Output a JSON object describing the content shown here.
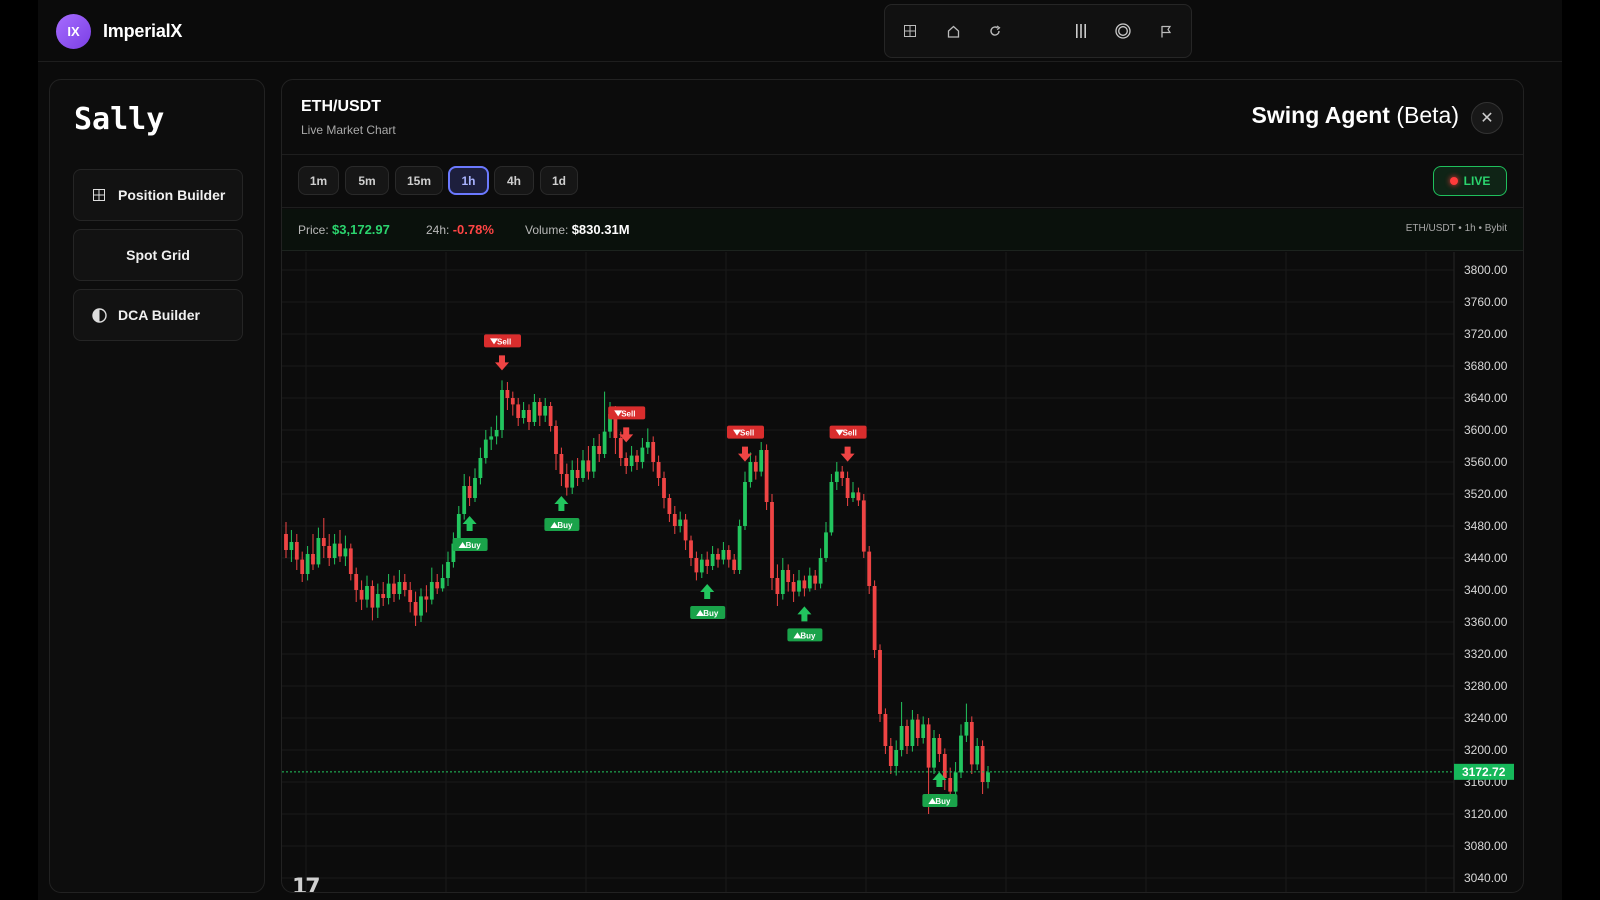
{
  "brand": {
    "logo_text": "IX",
    "name": "ImperialX"
  },
  "toolbar": {
    "icons": [
      "grid-icon",
      "home-icon",
      "refresh-icon",
      "bars-icon",
      "target-icon",
      "flag-icon"
    ]
  },
  "left_panel": {
    "title": "Sally",
    "items": [
      {
        "label": "Position Builder",
        "icon": "grid-icon"
      },
      {
        "label": "Spot Grid"
      },
      {
        "label": "DCA Builder",
        "icon": "half-circle-icon"
      }
    ]
  },
  "chart_panel": {
    "pair": "ETH/USDT",
    "subtitle": "Live Market Chart",
    "agent_name": "Swing Agent",
    "agent_tag": "(Beta)",
    "close_label": "✕",
    "timeframes": [
      "1m",
      "5m",
      "15m",
      "1h",
      "4h",
      "1d"
    ],
    "active_timeframe": "1h",
    "live_label": "LIVE",
    "stats": {
      "price_label": "Price:",
      "price_value": "$3,172.97",
      "change_label": "24h:",
      "change_value": "-0.78%",
      "volume_label": "Volume:",
      "volume_value": "$830.31M",
      "meta": "ETH/USDT • 1h • Bybit"
    },
    "tv_logo": "17",
    "colors": {
      "up": "#22c55e",
      "down": "#ef4444",
      "accent": "#6b79ff",
      "live": "#2bd46e"
    }
  },
  "chart_data": {
    "type": "candlestick",
    "y_ticks": [
      3800,
      3760,
      3720,
      3680,
      3640,
      3600,
      3560,
      3520,
      3480,
      3440,
      3400,
      3360,
      3320,
      3280,
      3240,
      3200,
      3160,
      3120,
      3080,
      3040
    ],
    "ylim": [
      3030,
      3810
    ],
    "current_price": "3172.72",
    "current_value": 3172.72,
    "grid": true,
    "candles": [
      [
        3470,
        3450,
        3485,
        3440
      ],
      [
        3450,
        3460,
        3475,
        3435
      ],
      [
        3460,
        3438,
        3470,
        3425
      ],
      [
        3438,
        3420,
        3448,
        3410
      ],
      [
        3420,
        3445,
        3455,
        3412
      ],
      [
        3445,
        3432,
        3470,
        3425
      ],
      [
        3432,
        3465,
        3478,
        3428
      ],
      [
        3465,
        3455,
        3490,
        3440
      ],
      [
        3455,
        3440,
        3470,
        3430
      ],
      [
        3440,
        3458,
        3470,
        3432
      ],
      [
        3458,
        3442,
        3475,
        3435
      ],
      [
        3442,
        3452,
        3468,
        3430
      ],
      [
        3452,
        3420,
        3458,
        3412
      ],
      [
        3420,
        3400,
        3428,
        3385
      ],
      [
        3400,
        3388,
        3412,
        3375
      ],
      [
        3388,
        3405,
        3418,
        3378
      ],
      [
        3405,
        3378,
        3412,
        3362
      ],
      [
        3378,
        3395,
        3408,
        3365
      ],
      [
        3395,
        3390,
        3410,
        3380
      ],
      [
        3390,
        3408,
        3420,
        3382
      ],
      [
        3408,
        3395,
        3418,
        3385
      ],
      [
        3395,
        3410,
        3425,
        3388
      ],
      [
        3410,
        3400,
        3420,
        3392
      ],
      [
        3400,
        3385,
        3410,
        3372
      ],
      [
        3385,
        3368,
        3398,
        3355
      ],
      [
        3368,
        3392,
        3402,
        3360
      ],
      [
        3392,
        3388,
        3406,
        3372
      ],
      [
        3388,
        3410,
        3428,
        3382
      ],
      [
        3410,
        3402,
        3420,
        3395
      ],
      [
        3402,
        3415,
        3432,
        3398
      ],
      [
        3415,
        3435,
        3448,
        3405
      ],
      [
        3435,
        3458,
        3472,
        3428
      ],
      [
        3458,
        3495,
        3505,
        3450
      ],
      [
        3495,
        3530,
        3545,
        3488
      ],
      [
        3530,
        3515,
        3542,
        3505
      ],
      [
        3515,
        3540,
        3552,
        3510
      ],
      [
        3540,
        3565,
        3578,
        3532
      ],
      [
        3565,
        3588,
        3600,
        3558
      ],
      [
        3588,
        3592,
        3604,
        3575
      ],
      [
        3592,
        3600,
        3618,
        3582
      ],
      [
        3600,
        3650,
        3662,
        3590
      ],
      [
        3650,
        3640,
        3660,
        3625
      ],
      [
        3640,
        3632,
        3648,
        3618
      ],
      [
        3632,
        3615,
        3640,
        3605
      ],
      [
        3615,
        3625,
        3635,
        3608
      ],
      [
        3625,
        3610,
        3632,
        3600
      ],
      [
        3610,
        3635,
        3645,
        3605
      ],
      [
        3635,
        3618,
        3640,
        3605
      ],
      [
        3618,
        3630,
        3640,
        3610
      ],
      [
        3630,
        3605,
        3635,
        3598
      ],
      [
        3605,
        3570,
        3612,
        3550
      ],
      [
        3570,
        3545,
        3578,
        3530
      ],
      [
        3545,
        3528,
        3558,
        3518
      ],
      [
        3528,
        3550,
        3562,
        3520
      ],
      [
        3550,
        3540,
        3565,
        3530
      ],
      [
        3540,
        3562,
        3575,
        3535
      ],
      [
        3562,
        3548,
        3580,
        3538
      ],
      [
        3548,
        3580,
        3590,
        3540
      ],
      [
        3580,
        3570,
        3595,
        3560
      ],
      [
        3570,
        3598,
        3648,
        3565
      ],
      [
        3598,
        3620,
        3635,
        3590
      ],
      [
        3620,
        3590,
        3630,
        3570
      ],
      [
        3590,
        3565,
        3598,
        3555
      ],
      [
        3565,
        3555,
        3572,
        3545
      ],
      [
        3555,
        3568,
        3580,
        3548
      ],
      [
        3568,
        3560,
        3575,
        3550
      ],
      [
        3560,
        3578,
        3590,
        3552
      ],
      [
        3578,
        3585,
        3602,
        3570
      ],
      [
        3585,
        3560,
        3592,
        3548
      ],
      [
        3560,
        3540,
        3568,
        3530
      ],
      [
        3540,
        3515,
        3548,
        3502
      ],
      [
        3515,
        3495,
        3520,
        3485
      ],
      [
        3495,
        3480,
        3505,
        3470
      ],
      [
        3480,
        3488,
        3498,
        3472
      ],
      [
        3488,
        3462,
        3495,
        3450
      ],
      [
        3462,
        3440,
        3468,
        3430
      ],
      [
        3440,
        3422,
        3448,
        3412
      ],
      [
        3422,
        3438,
        3445,
        3415
      ],
      [
        3438,
        3430,
        3448,
        3420
      ],
      [
        3430,
        3445,
        3455,
        3425
      ],
      [
        3445,
        3438,
        3452,
        3428
      ],
      [
        3438,
        3450,
        3460,
        3432
      ],
      [
        3450,
        3438,
        3456,
        3428
      ],
      [
        3438,
        3425,
        3445,
        3420
      ],
      [
        3425,
        3480,
        3488,
        3420
      ],
      [
        3480,
        3535,
        3548,
        3475
      ],
      [
        3535,
        3560,
        3572,
        3528
      ],
      [
        3560,
        3548,
        3568,
        3538
      ],
      [
        3548,
        3575,
        3585,
        3542
      ],
      [
        3575,
        3510,
        3582,
        3500
      ],
      [
        3510,
        3415,
        3520,
        3400
      ],
      [
        3415,
        3395,
        3432,
        3380
      ],
      [
        3395,
        3425,
        3440,
        3388
      ],
      [
        3425,
        3410,
        3432,
        3398
      ],
      [
        3410,
        3398,
        3420,
        3385
      ],
      [
        3398,
        3412,
        3425,
        3392
      ],
      [
        3412,
        3402,
        3418,
        3392
      ],
      [
        3402,
        3418,
        3428,
        3398
      ],
      [
        3418,
        3408,
        3425,
        3400
      ],
      [
        3408,
        3440,
        3452,
        3402
      ],
      [
        3440,
        3472,
        3485,
        3435
      ],
      [
        3472,
        3535,
        3545,
        3468
      ],
      [
        3535,
        3548,
        3560,
        3525
      ],
      [
        3548,
        3540,
        3555,
        3530
      ],
      [
        3540,
        3515,
        3548,
        3505
      ],
      [
        3515,
        3522,
        3535,
        3510
      ],
      [
        3522,
        3512,
        3528,
        3505
      ],
      [
        3512,
        3448,
        3520,
        3440
      ],
      [
        3448,
        3405,
        3455,
        3395
      ],
      [
        3405,
        3325,
        3412,
        3315
      ],
      [
        3325,
        3245,
        3332,
        3235
      ],
      [
        3245,
        3205,
        3252,
        3195
      ],
      [
        3205,
        3180,
        3215,
        3170
      ],
      [
        3180,
        3200,
        3212,
        3168
      ],
      [
        3200,
        3230,
        3260,
        3192
      ],
      [
        3230,
        3205,
        3238,
        3195
      ],
      [
        3205,
        3238,
        3250,
        3198
      ],
      [
        3238,
        3215,
        3245,
        3205
      ],
      [
        3215,
        3232,
        3242,
        3208
      ],
      [
        3232,
        3178,
        3240,
        3120
      ],
      [
        3178,
        3215,
        3225,
        3170
      ],
      [
        3215,
        3195,
        3220,
        3185
      ],
      [
        3195,
        3165,
        3202,
        3150
      ],
      [
        3165,
        3148,
        3178,
        3132
      ],
      [
        3148,
        3172,
        3185,
        3140
      ],
      [
        3172,
        3218,
        3232,
        3165
      ],
      [
        3218,
        3235,
        3258,
        3210
      ],
      [
        3235,
        3182,
        3242,
        3170
      ],
      [
        3182,
        3205,
        3215,
        3175
      ],
      [
        3205,
        3160,
        3212,
        3145
      ],
      [
        3160,
        3172,
        3180,
        3152
      ]
    ],
    "signals": [
      {
        "index": 34,
        "type": "buy",
        "label": "Buy"
      },
      {
        "index": 40,
        "type": "sell",
        "label": "Sell"
      },
      {
        "index": 51,
        "type": "buy",
        "label": "Buy"
      },
      {
        "index": 63,
        "type": "sell",
        "label": "Sell"
      },
      {
        "index": 78,
        "type": "buy",
        "label": "Buy"
      },
      {
        "index": 85,
        "type": "sell",
        "label": "Sell"
      },
      {
        "index": 96,
        "type": "buy",
        "label": "Buy"
      },
      {
        "index": 104,
        "type": "sell",
        "label": "Sell"
      },
      {
        "index": 121,
        "type": "buy",
        "label": "Buy"
      }
    ]
  }
}
